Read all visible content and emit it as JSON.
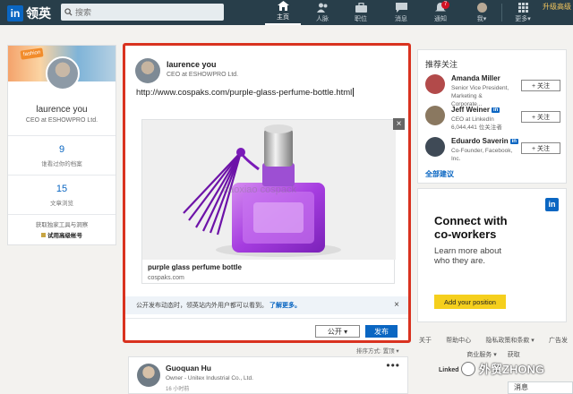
{
  "nav": {
    "logo_text": "领英",
    "search_placeholder": "搜索",
    "items": [
      {
        "label": "主页",
        "icon": "home-icon"
      },
      {
        "label": "人脉",
        "icon": "people-icon"
      },
      {
        "label": "职位",
        "icon": "briefcase-icon"
      },
      {
        "label": "消息",
        "icon": "message-icon"
      },
      {
        "label": "通知",
        "icon": "bell-icon",
        "badge": "7"
      },
      {
        "label": "我▾",
        "icon": "avatar"
      },
      {
        "label": "更多▾",
        "icon": "grid-icon"
      }
    ],
    "upgrade": "升级高级"
  },
  "profile": {
    "cover_tag": "fashion",
    "name": "laurence you",
    "title": "CEO at ESHOWPRO Ltd.",
    "stats": [
      {
        "value": "9",
        "label": "谁看过你的档案"
      },
      {
        "value": "15",
        "label": "文章浏览"
      }
    ],
    "tools_text": "获取独家工具与洞察",
    "premium_text": "试用高级帐号"
  },
  "composer": {
    "name": "laurence you",
    "title": "CEO at ESHOWPRO Ltd.",
    "url": "http://www.cospaks.com/purple-glass-perfume-bottle.html",
    "preview": {
      "watermark": "haoxiao cospack",
      "title": "purple glass perfume bottle",
      "domain": "cospaks.com",
      "close": "×"
    },
    "notice": "公开发布动态时，领英站内外用户都可以看到。",
    "notice_link": "了解更多。",
    "notice_close": "×",
    "visibility": "公开 ▾",
    "post": "发布"
  },
  "sort_text": "排序方式: 置顶 ▾",
  "feed": {
    "name": "Guoquan Hu",
    "title": "Owner - Unitex Industrial Co., Ltd.",
    "time": "16 小时前",
    "more": "•••"
  },
  "follow": {
    "heading": "推荐关注",
    "items": [
      {
        "name": "Amanda Miller",
        "title": "Senior Vice President, Marketing & Corporate...",
        "button": "+ 关注",
        "has_in": false,
        "color": "#b24a4a"
      },
      {
        "name": "Jeff Weiner",
        "title": "CEO at LinkedIn 6,044,441 位关注者",
        "button": "+ 关注",
        "has_in": true,
        "color": "#8a7860"
      },
      {
        "name": "Eduardo Saverin",
        "title": "Co-Founder, Facebook, Inc.",
        "button": "+ 关注",
        "has_in": true,
        "color": "#3f4a56"
      }
    ],
    "all": "全部建议"
  },
  "ad": {
    "badge": "in",
    "heading_1": "Connect with",
    "heading_2": "co-workers",
    "sub_1": "Learn more about",
    "sub_2": "who they are.",
    "button": "Add your position"
  },
  "footer": {
    "row1": [
      "关于",
      "帮助中心",
      "隐私政策和条款 ▾",
      "广告发"
    ],
    "row2": [
      "商业服务 ▾",
      "获取"
    ],
    "brand": "Linked"
  },
  "watermark": "外贸ZHONG",
  "messages_tab": "消息"
}
